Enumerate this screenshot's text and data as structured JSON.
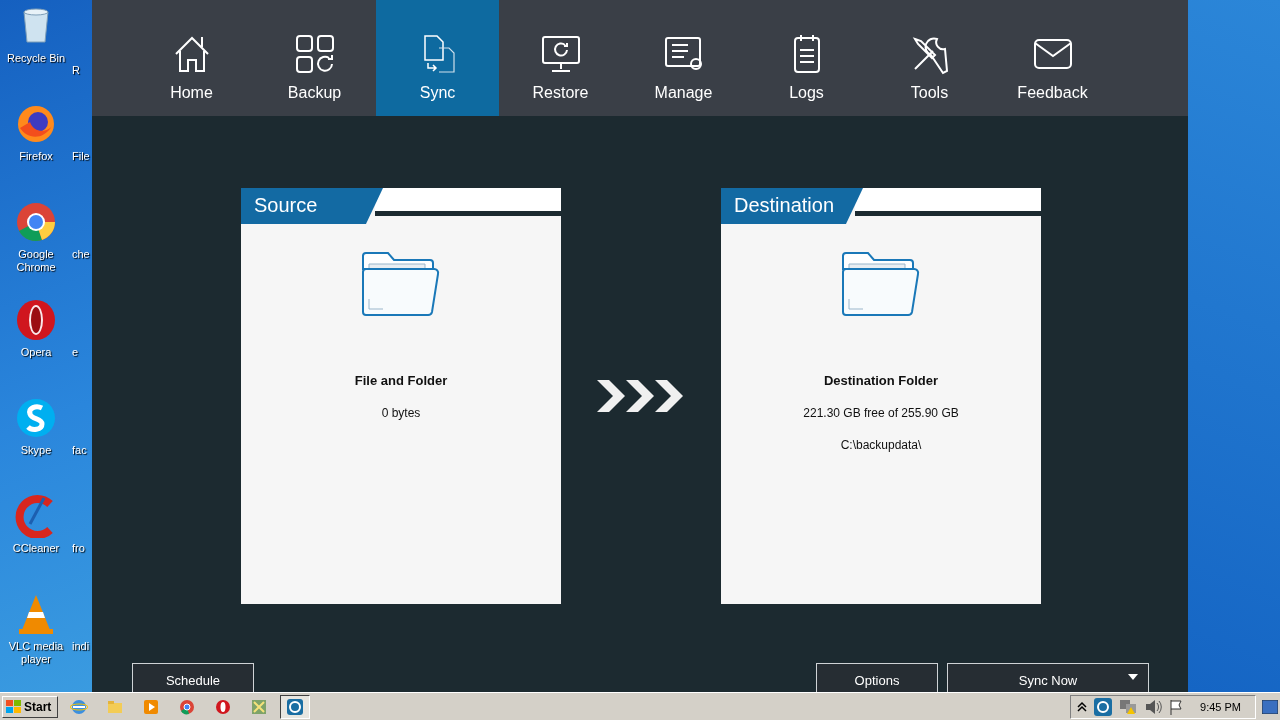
{
  "desktop": {
    "icons": [
      {
        "label": "Recycle Bin",
        "second_label": "R"
      },
      {
        "label": "Firefox",
        "second_label": "File"
      },
      {
        "label": "Google Chrome",
        "second_label": "che"
      },
      {
        "label": "Opera",
        "second_label": "e"
      },
      {
        "label": "Skype",
        "second_label": "fac"
      },
      {
        "label": "CCleaner",
        "second_label": "fro"
      },
      {
        "label": "VLC media player",
        "second_label": "indi"
      }
    ]
  },
  "toolbar": {
    "tabs": [
      {
        "label": "Home",
        "selected": false
      },
      {
        "label": "Backup",
        "selected": false
      },
      {
        "label": "Sync",
        "selected": true
      },
      {
        "label": "Restore",
        "selected": false
      },
      {
        "label": "Manage",
        "selected": false
      },
      {
        "label": "Logs",
        "selected": false
      },
      {
        "label": "Tools",
        "selected": false
      },
      {
        "label": "Feedback",
        "selected": false
      }
    ]
  },
  "source": {
    "title": "Source",
    "heading": "File and Folder",
    "lines": [
      "0 bytes"
    ]
  },
  "destination": {
    "title": "Destination",
    "heading": "Destination Folder",
    "lines": [
      "221.30 GB free of 255.90 GB",
      "C:\\backupdata\\"
    ]
  },
  "buttons": {
    "schedule": "Schedule",
    "options": "Options",
    "sync_now": "Sync Now"
  },
  "taskbar": {
    "start": "Start",
    "apps": [
      {
        "selected": false
      },
      {
        "selected": false
      },
      {
        "selected": false
      },
      {
        "selected": false
      },
      {
        "selected": false
      },
      {
        "selected": false
      },
      {
        "selected": true
      }
    ],
    "clock": "9:45 PM"
  }
}
